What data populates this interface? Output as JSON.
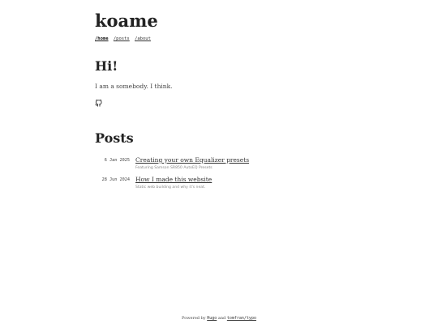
{
  "site": {
    "title": "koame"
  },
  "nav": {
    "items": [
      {
        "label": "/home",
        "active": true
      },
      {
        "label": "/posts",
        "active": false
      },
      {
        "label": "/about",
        "active": false
      }
    ]
  },
  "intro": {
    "heading": "Hi!",
    "text": "I am a somebody. I think.",
    "social_icon": "github-icon"
  },
  "posts": {
    "heading": "Posts",
    "items": [
      {
        "date": "6 Jan 2025",
        "title": "Creating your own Equalizer presets",
        "subtitle": "Featuring Samson SR850 AutoEQ Presets"
      },
      {
        "date": "28 Jun 2024",
        "title": "How I made this website",
        "subtitle": "Static web building and why it's neat."
      }
    ]
  },
  "footer": {
    "prefix": "Powered by",
    "link1": "Hugo",
    "joiner": "and",
    "link2": "tomfran/typo"
  }
}
